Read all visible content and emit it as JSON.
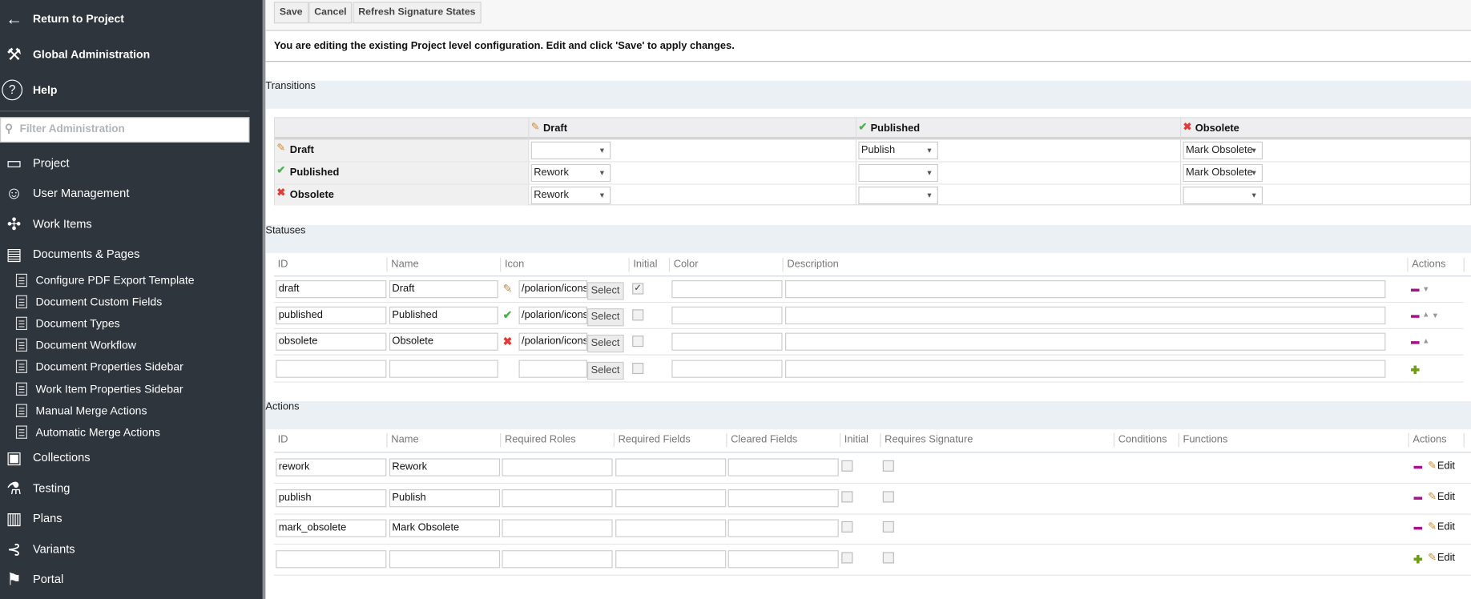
{
  "sidebar": {
    "top": [
      {
        "label": "Return to Project",
        "icon": "arrow-left-icon"
      },
      {
        "label": "Global Administration",
        "icon": "wrench-icon"
      },
      {
        "label": "Help",
        "icon": "help-circle-icon"
      }
    ],
    "filter_placeholder": "Filter Administration",
    "items": [
      {
        "label": "Project",
        "icon": "folder-icon"
      },
      {
        "label": "User Management",
        "icon": "users-icon"
      },
      {
        "label": "Work Items",
        "icon": "puzzle-icon"
      },
      {
        "label": "Documents & Pages",
        "icon": "document-icon"
      }
    ],
    "subitems": [
      "Configure PDF Export Template",
      "Document Custom Fields",
      "Document Types",
      "Document Workflow",
      "Document Properties Sidebar",
      "Work Item Properties Sidebar",
      "Manual Merge Actions",
      "Automatic Merge Actions"
    ],
    "items2": [
      {
        "label": "Collections",
        "icon": "archive-box-icon"
      },
      {
        "label": "Testing",
        "icon": "flask-icon"
      },
      {
        "label": "Plans",
        "icon": "bar-chart-icon"
      },
      {
        "label": "Variants",
        "icon": "branch-icon"
      },
      {
        "label": "Portal",
        "icon": "signpost-icon"
      }
    ]
  },
  "toolbar": {
    "save": "Save",
    "cancel": "Cancel",
    "refresh": "Refresh Signature States"
  },
  "message": "You are editing the existing Project level configuration. Edit and click 'Save' to apply changes.",
  "transitions": {
    "title": "Transitions",
    "columns": [
      "Draft",
      "Published",
      "Obsolete"
    ],
    "rows": [
      {
        "label": "Draft",
        "cells": [
          "",
          "Publish",
          "Mark Obsolete"
        ]
      },
      {
        "label": "Published",
        "cells": [
          "Rework",
          "",
          "Mark Obsolete"
        ]
      },
      {
        "label": "Obsolete",
        "cells": [
          "Rework",
          "",
          ""
        ]
      }
    ]
  },
  "statuses": {
    "title": "Statuses",
    "headers": [
      "ID",
      "Name",
      "Icon",
      "Initial",
      "Color",
      "Description",
      "Actions"
    ],
    "select_label": "Select",
    "rows": [
      {
        "id": "draft",
        "name": "Draft",
        "icon": "pencil-icon",
        "icon_path": "/polarion/icons/",
        "initial": true,
        "color": "",
        "description": ""
      },
      {
        "id": "published",
        "name": "Published",
        "icon": "check-icon",
        "icon_path": "/polarion/icons/",
        "initial": false,
        "color": "",
        "description": ""
      },
      {
        "id": "obsolete",
        "name": "Obsolete",
        "icon": "x-icon",
        "icon_path": "/polarion/icons/",
        "initial": false,
        "color": "",
        "description": ""
      },
      {
        "id": "",
        "name": "",
        "icon": "",
        "icon_path": "",
        "initial": false,
        "color": "",
        "description": ""
      }
    ]
  },
  "actions": {
    "title": "Actions",
    "headers": [
      "ID",
      "Name",
      "Required Roles",
      "Required Fields",
      "Cleared Fields",
      "Initial",
      "Requires Signature",
      "Conditions",
      "Functions",
      "Actions"
    ],
    "edit_label": "Edit",
    "rows": [
      {
        "id": "rework",
        "name": "Rework"
      },
      {
        "id": "publish",
        "name": "Publish"
      },
      {
        "id": "mark_obsolete",
        "name": "Mark Obsolete"
      },
      {
        "id": "",
        "name": ""
      }
    ]
  },
  "colors": {
    "sidebar": "#2e353c",
    "section_title": "#1b4f72",
    "remove": "#a5118a",
    "add": "#6f9d12"
  }
}
